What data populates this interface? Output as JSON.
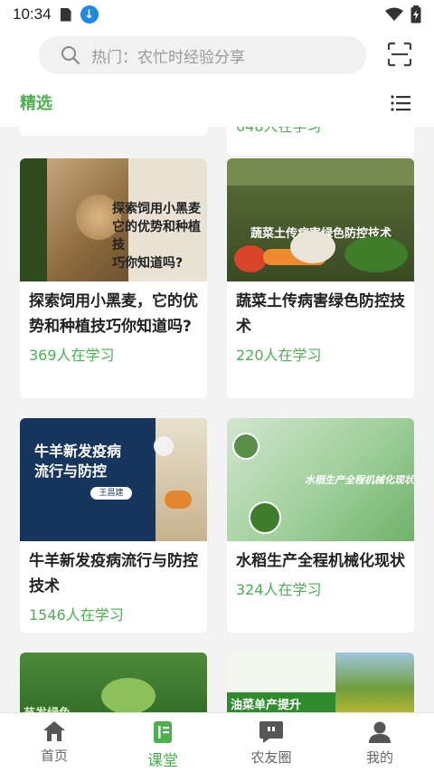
{
  "status": {
    "time": "10:34",
    "download_icon": "download-icon"
  },
  "search": {
    "placeholder": "热门：农忙时经验分享"
  },
  "tab": {
    "active_label": "精选"
  },
  "top_partial": {
    "learners": "648人在学习"
  },
  "cards": [
    {
      "title": "探索饲用小黑麦，它的优势和种植技巧你知道吗?",
      "learners": "369人在学习",
      "img_text": [
        "探索饲用小黑麦",
        "它的优势和种植技",
        "巧你知道吗?"
      ]
    },
    {
      "title": "蔬菜土传病害绿色防控技术",
      "learners": "220人在学习",
      "img_text": [
        "蔬菜土传病害绿色防控技术"
      ]
    },
    {
      "title": "牛羊新发疫病流行与防控技术",
      "learners": "1546人在学习",
      "img_text": [
        "牛羊新发疫病",
        "流行与防控",
        "王昌建"
      ]
    },
    {
      "title": "水稻生产全程机械化现状",
      "learners": "324人在学习",
      "img_text": [
        "水稻生产全程机械化现状"
      ]
    }
  ],
  "partial_cards": [
    {
      "img_text": "苗发绿色"
    },
    {
      "img_text": "油菜单产提升"
    }
  ],
  "nav": [
    {
      "label": "首页",
      "icon": "home-icon"
    },
    {
      "label": "课堂",
      "icon": "classroom-icon"
    },
    {
      "label": "农友圈",
      "icon": "chat-icon"
    },
    {
      "label": "我的",
      "icon": "profile-icon"
    }
  ],
  "colors": {
    "accent": "#4caf50",
    "download": "#1e88e5"
  }
}
